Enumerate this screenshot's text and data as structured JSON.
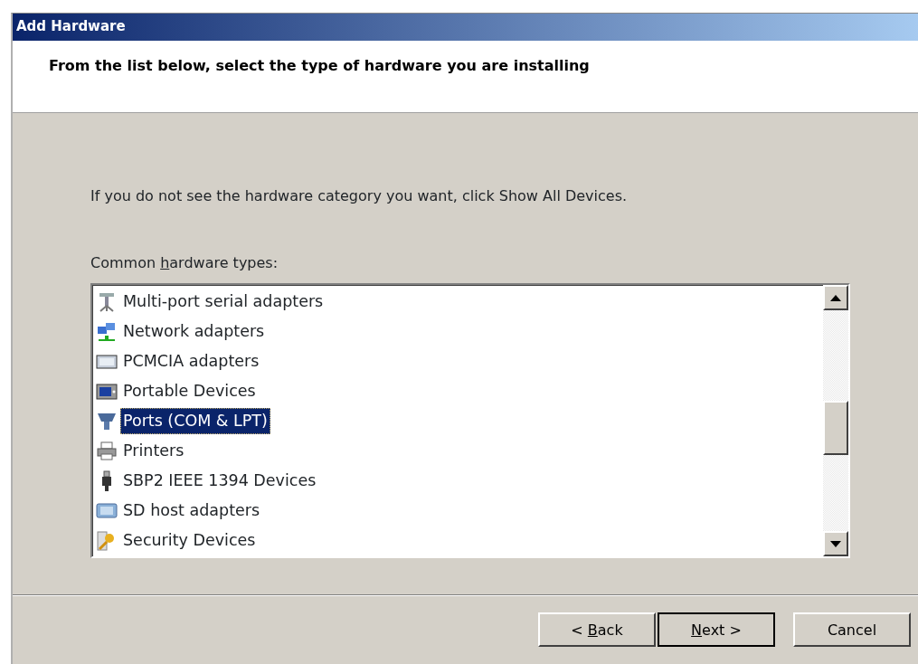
{
  "window": {
    "title": "Add Hardware"
  },
  "header": {
    "heading": "From the list below, select the type of hardware you are installing"
  },
  "instruction": "If you do not see the hardware category you want, click Show All Devices.",
  "list_label": {
    "before": "Common ",
    "key": "h",
    "after": "ardware types:"
  },
  "hardware_types": [
    {
      "label": "Multi-port serial adapters",
      "kind": "serial",
      "selected": false
    },
    {
      "label": "Network adapters",
      "kind": "network",
      "selected": false
    },
    {
      "label": "PCMCIA adapters",
      "kind": "card",
      "selected": false
    },
    {
      "label": "Portable Devices",
      "kind": "portable",
      "selected": false
    },
    {
      "label": "Ports (COM & LPT)",
      "kind": "port",
      "selected": true
    },
    {
      "label": "Printers",
      "kind": "printer",
      "selected": false
    },
    {
      "label": "SBP2 IEEE 1394 Devices",
      "kind": "plug",
      "selected": false
    },
    {
      "label": "SD host adapters",
      "kind": "sd",
      "selected": false
    },
    {
      "label": "Security Devices",
      "kind": "key",
      "selected": false
    }
  ],
  "buttons": [
    {
      "before": "< ",
      "key": "B",
      "after": "ack",
      "default": false
    },
    {
      "key": "N",
      "after": "ext >",
      "default": true
    },
    {
      "before": "Cancel",
      "default": false
    }
  ]
}
